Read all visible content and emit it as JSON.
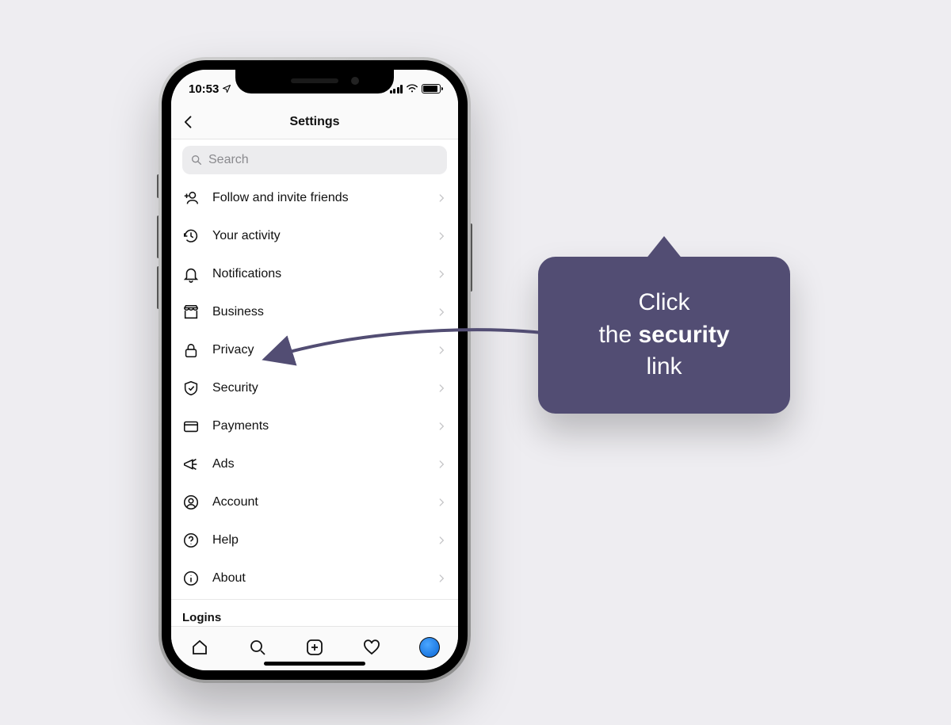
{
  "status": {
    "time": "10:53"
  },
  "header": {
    "title": "Settings"
  },
  "search": {
    "placeholder": "Search"
  },
  "menu": {
    "items": [
      {
        "label": "Follow and invite friends"
      },
      {
        "label": "Your activity"
      },
      {
        "label": "Notifications"
      },
      {
        "label": "Business"
      },
      {
        "label": "Privacy"
      },
      {
        "label": "Security"
      },
      {
        "label": "Payments"
      },
      {
        "label": "Ads"
      },
      {
        "label": "Account"
      },
      {
        "label": "Help"
      },
      {
        "label": "About"
      }
    ],
    "section_heading": "Logins"
  },
  "callout": {
    "line1": "Click",
    "line2_pre": "the ",
    "line2_bold": "security",
    "line3": "link"
  },
  "colors": {
    "callout_bg": "#524d73",
    "accent_blue": "#1e87ff"
  }
}
